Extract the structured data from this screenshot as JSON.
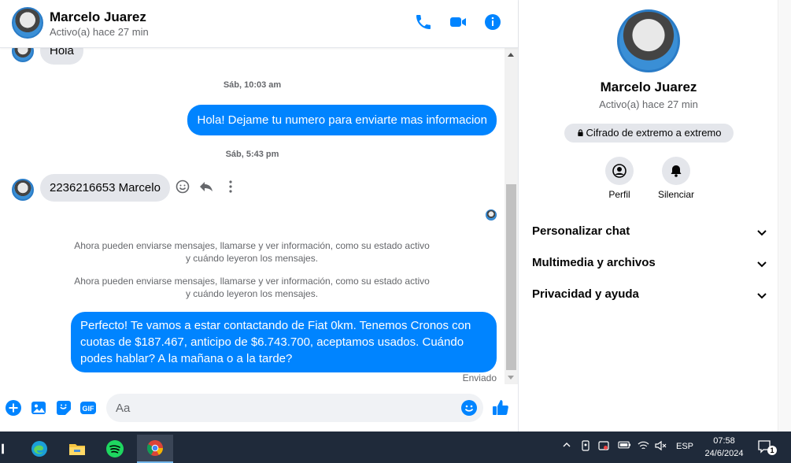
{
  "contact": {
    "name": "Marcelo Juarez",
    "status": "Activo(a) hace 27 min"
  },
  "messages": {
    "partial_in": "Hola",
    "time1": "Sáb, 10:03 am",
    "out1": "Hola! Dejame tu numero para enviarte mas informacion",
    "time2": "Sáb, 5:43 pm",
    "in1": "2236216653 Marcelo",
    "system1": "Ahora pueden enviarse mensajes, llamarse y ver información, como su estado activo y cuándo leyeron los mensajes.",
    "system2": "Ahora pueden enviarse mensajes, llamarse y ver información, como su estado activo y cuándo leyeron los mensajes.",
    "out2": "Perfecto! Te vamos a estar contactando de Fiat 0km. Tenemos Cronos con cuotas de $187.467, anticipo de $6.743.700, aceptamos usados. Cuándo podes hablar? A la mañana o a la tarde?",
    "sent_label": "Enviado"
  },
  "composer": {
    "placeholder": "Aa"
  },
  "info_panel": {
    "e2e_label": "Cifrado de extremo a extremo",
    "profile_label": "Perfil",
    "mute_label": "Silenciar",
    "sections": [
      "Personalizar chat",
      "Multimedia y archivos",
      "Privacidad y ayuda"
    ]
  },
  "taskbar": {
    "language": "ESP",
    "time": "07:58",
    "date": "24/6/2024",
    "notifications": "1"
  },
  "colors": {
    "accent": "#0084ff",
    "bubble_in": "#e4e6eb",
    "taskbar": "#1f2a3a"
  }
}
